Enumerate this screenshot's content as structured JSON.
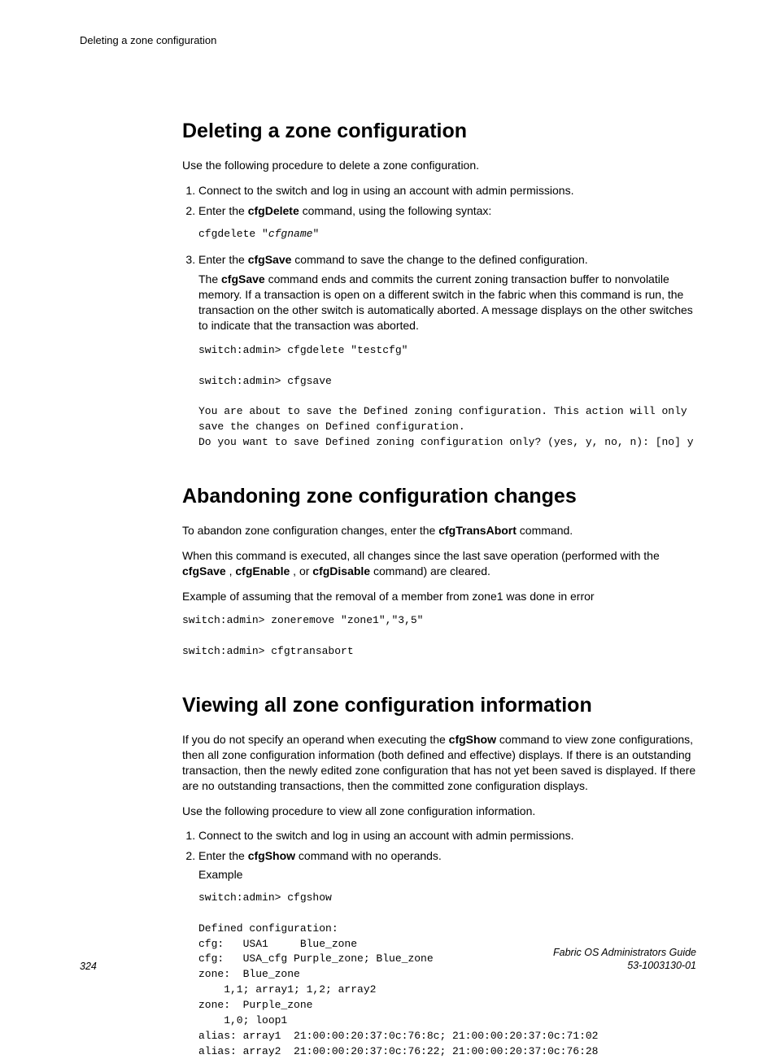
{
  "header": {
    "running": "Deleting a zone configuration"
  },
  "footer": {
    "page": "324",
    "title": "Fabric OS Administrators Guide",
    "docnum": "53-1003130-01"
  },
  "s1": {
    "title": "Deleting a zone configuration",
    "intro": "Use the following procedure to delete a zone configuration.",
    "li1": "Connect to the switch and log in using an account with admin permissions.",
    "li2_a": "Enter the ",
    "li2_cmd": "cfgDelete",
    "li2_b": " command, using the following syntax:",
    "code1a": "cfgdelete \"",
    "code1b": "cfgname",
    "code1c": "\"",
    "li3_a": "Enter the ",
    "li3_cmd": "cfgSave",
    "li3_b": " command to save the change to the defined configuration.",
    "para_a": "The ",
    "para_cmd": "cfgSave",
    "para_b": " command ends and commits the current zoning transaction buffer to nonvolatile memory. If a transaction is open on a different switch in the fabric when this command is run, the transaction on the other switch is automatically aborted. A message displays on the other switches to indicate that the transaction was aborted.",
    "code2": "switch:admin> cfgdelete \"testcfg\"\n\nswitch:admin> cfgsave\n\nYou are about to save the Defined zoning configuration. This action will only\nsave the changes on Defined configuration.\nDo you want to save Defined zoning configuration only? (yes, y, no, n): [no] y"
  },
  "s2": {
    "title": "Abandoning zone configuration changes",
    "p1_a": "To abandon zone configuration changes, enter the ",
    "p1_cmd": "cfgTransAbort",
    "p1_b": " command.",
    "p2_a": "When this command is executed, all changes since the last save operation (performed with the ",
    "p2_c1": "cfgSave",
    "p2_sep1": " , ",
    "p2_c2": "cfgEnable",
    "p2_sep2": " , or ",
    "p2_c3": "cfgDisable",
    "p2_b": " command) are cleared.",
    "p3": "Example of assuming that the removal of a member from zone1 was done in error",
    "code": "switch:admin> zoneremove \"zone1\",\"3,5\"\n\nswitch:admin> cfgtransabort"
  },
  "s3": {
    "title": "Viewing all zone configuration information",
    "p1_a": "If you do not specify an operand when executing the ",
    "p1_cmd": "cfgShow",
    "p1_b": " command to view zone configurations, then all zone configuration information (both defined and effective) displays. If there is an outstanding transaction, then the newly edited zone configuration that has not yet been saved is displayed. If there are no outstanding transactions, then the committed zone configuration displays.",
    "p2": "Use the following procedure to view all zone configuration information.",
    "li1": "Connect to the switch and log in using an account with admin permissions.",
    "li2_a": "Enter the ",
    "li2_cmd": "cfgShow",
    "li2_b": " command with no operands.",
    "example_label": "Example",
    "code": "switch:admin> cfgshow\n\nDefined configuration:\ncfg:   USA1     Blue_zone\ncfg:   USA_cfg Purple_zone; Blue_zone\nzone:  Blue_zone\n    1,1; array1; 1,2; array2\nzone:  Purple_zone\n    1,0; loop1\nalias: array1  21:00:00:20:37:0c:76:8c; 21:00:00:20:37:0c:71:02\nalias: array2  21:00:00:20:37:0c:76:22; 21:00:00:20:37:0c:76:28"
  }
}
